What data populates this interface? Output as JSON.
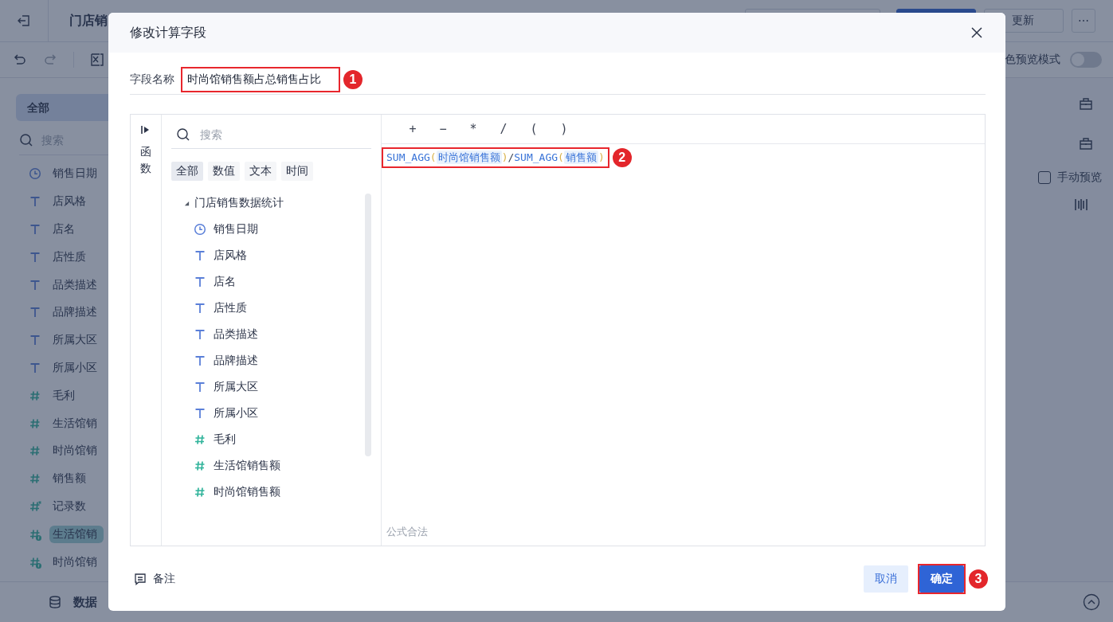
{
  "app": {
    "title": "门店销",
    "update_button": "更新",
    "more_button": "⋯",
    "preview_mode_label": "色预览模式",
    "preview_mode_on": false
  },
  "sidebar": {
    "tabs": [
      {
        "label": "全部",
        "selected": true
      }
    ],
    "search_placeholder": "搜索",
    "fields": [
      {
        "kind": "date",
        "name": "销售日期",
        "selected": false
      },
      {
        "kind": "text",
        "name": "店风格",
        "selected": false
      },
      {
        "kind": "text",
        "name": "店名",
        "selected": false
      },
      {
        "kind": "text",
        "name": "店性质",
        "selected": false
      },
      {
        "kind": "text",
        "name": "品类描述",
        "selected": false
      },
      {
        "kind": "text",
        "name": "品牌描述",
        "selected": false
      },
      {
        "kind": "text",
        "name": "所属大区",
        "selected": false
      },
      {
        "kind": "text",
        "name": "所属小区",
        "selected": false
      },
      {
        "kind": "number",
        "name": "毛利",
        "selected": false
      },
      {
        "kind": "number",
        "name": "生活馆销",
        "selected": false
      },
      {
        "kind": "number",
        "name": "时尚馆销",
        "selected": false
      },
      {
        "kind": "number",
        "name": "销售额",
        "selected": false
      },
      {
        "kind": "count",
        "name": "记录数",
        "selected": false
      },
      {
        "kind": "calc",
        "name": "生活馆销",
        "selected": true
      },
      {
        "kind": "calc",
        "name": "时尚馆销",
        "selected": false
      }
    ],
    "bottom_tab": "数据"
  },
  "right_panel": {
    "manual_preview": {
      "label": "手动预览",
      "checked": false
    }
  },
  "dialog": {
    "title": "修改计算字段",
    "field_name": {
      "label": "字段名称",
      "value": "时尚馆销售额占总销售占比",
      "callout": "1"
    },
    "function_tab": {
      "label": "函数"
    },
    "field_panel": {
      "search_placeholder": "搜索",
      "filters": [
        {
          "label": "全部",
          "selected": true
        },
        {
          "label": "数值",
          "selected": false
        },
        {
          "label": "文本",
          "selected": false
        },
        {
          "label": "时间",
          "selected": false
        }
      ],
      "tree": [
        {
          "name": "门店销售数据统计",
          "expanded": true,
          "children": [
            {
              "kind": "date",
              "name": "销售日期"
            },
            {
              "kind": "text",
              "name": "店风格"
            },
            {
              "kind": "text",
              "name": "店名"
            },
            {
              "kind": "text",
              "name": "店性质"
            },
            {
              "kind": "text",
              "name": "品类描述"
            },
            {
              "kind": "text",
              "name": "品牌描述"
            },
            {
              "kind": "text",
              "name": "所属大区"
            },
            {
              "kind": "text",
              "name": "所属小区"
            },
            {
              "kind": "number",
              "name": "毛利"
            },
            {
              "kind": "number",
              "name": "生活馆销售额"
            },
            {
              "kind": "number",
              "name": "时尚馆销售额"
            }
          ]
        }
      ]
    },
    "operators": [
      "+",
      "−",
      "*",
      "/",
      "(",
      ")"
    ],
    "formula": {
      "tokens": [
        {
          "kind": "func",
          "text": "SUM_AGG"
        },
        {
          "kind": "paren",
          "text": "("
        },
        {
          "kind": "field",
          "text": "时尚馆销售额"
        },
        {
          "kind": "paren",
          "text": ")"
        },
        {
          "kind": "op",
          "text": "/"
        },
        {
          "kind": "func",
          "text": "SUM_AGG"
        },
        {
          "kind": "paren",
          "text": "("
        },
        {
          "kind": "field",
          "text": "销售额"
        },
        {
          "kind": "paren",
          "text": ")"
        }
      ],
      "callout": "2",
      "status": "公式合法"
    },
    "note_button": "备注",
    "buttons": [
      {
        "kind": "secondary",
        "label": "取消"
      },
      {
        "kind": "primary",
        "label": "确定",
        "callout": "3"
      }
    ]
  }
}
